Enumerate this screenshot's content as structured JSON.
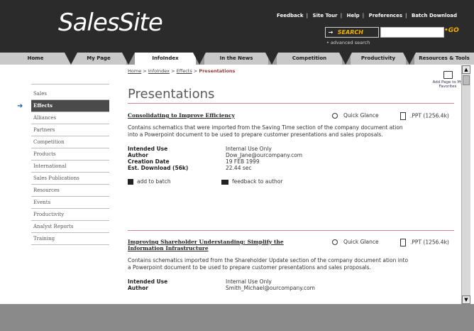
{
  "header": {
    "logo": "SalesSite",
    "links": [
      "Feedback",
      "Site Tour",
      "Help",
      "Preferences",
      "Batch Download"
    ],
    "search_label": "SEARCH",
    "search_value": "",
    "go_label": "GO",
    "advanced_search": "advanced search"
  },
  "nav": {
    "tabs": [
      "Home",
      "My Page",
      "InfoIndex",
      "In the News",
      "Competition",
      "Productivity",
      "Resources & Tools"
    ],
    "active": "InfoIndex"
  },
  "sidebar": {
    "items": [
      "Sales",
      "Effects",
      "Alliances",
      "Partners",
      "Competition",
      "Products",
      "International",
      "Sales Publications",
      "Resources",
      "Events",
      "Productivity",
      "Analyst Reports",
      "Training"
    ],
    "active": "Effects"
  },
  "breadcrumb": {
    "items": [
      "Home",
      "InfoIndex",
      "Effects",
      "Presentations"
    ],
    "separator": ">"
  },
  "page": {
    "title": "Presentations",
    "favorites_label": "Add Page to My Favorites"
  },
  "items": [
    {
      "title": "Consolidating to Improve Efficiency",
      "quick_glance": "Quick Glance",
      "ppt": ".PPT (1256.4k)",
      "description": "Contains schematics that were imported from the Saving Time section of the company document ation into a Powerpoint document to be used to prepare customer presentations and sales proposals.",
      "meta": [
        {
          "key": "Intended Use",
          "value": "Internal Use Only"
        },
        {
          "key": "Author",
          "value": "Dow_Jane@ourcompany.com"
        },
        {
          "key": "Creation Date",
          "value": "19 FEB 1999"
        },
        {
          "key": "Est. Download (56k)",
          "value": "22.44 sec"
        }
      ],
      "add_to_batch": "add to batch",
      "feedback": "feedback to author"
    },
    {
      "title": "Improving Shareholder Understanding: Simplify the Information Infrastructure",
      "quick_glance": "Quick Glance",
      "ppt": ".PPT (1256.4k)",
      "description": "Contains schematics imported from the Shareholder Update section of the company document ation into a Powerpoint document to be used to prepare customer presentations and sales proposals.",
      "meta": [
        {
          "key": "Intended Use",
          "value": "Internal Use Only"
        },
        {
          "key": "Author",
          "value": "Smith_Michael@ourcompany.com"
        }
      ]
    }
  ],
  "colors": {
    "header_bg": "#2b2b2b",
    "accent_gold": "#f0b000",
    "sidebar_active_bg": "#4a4a4a",
    "arrow_blue": "#1d5fa8",
    "rule_red": "#cc8888"
  }
}
